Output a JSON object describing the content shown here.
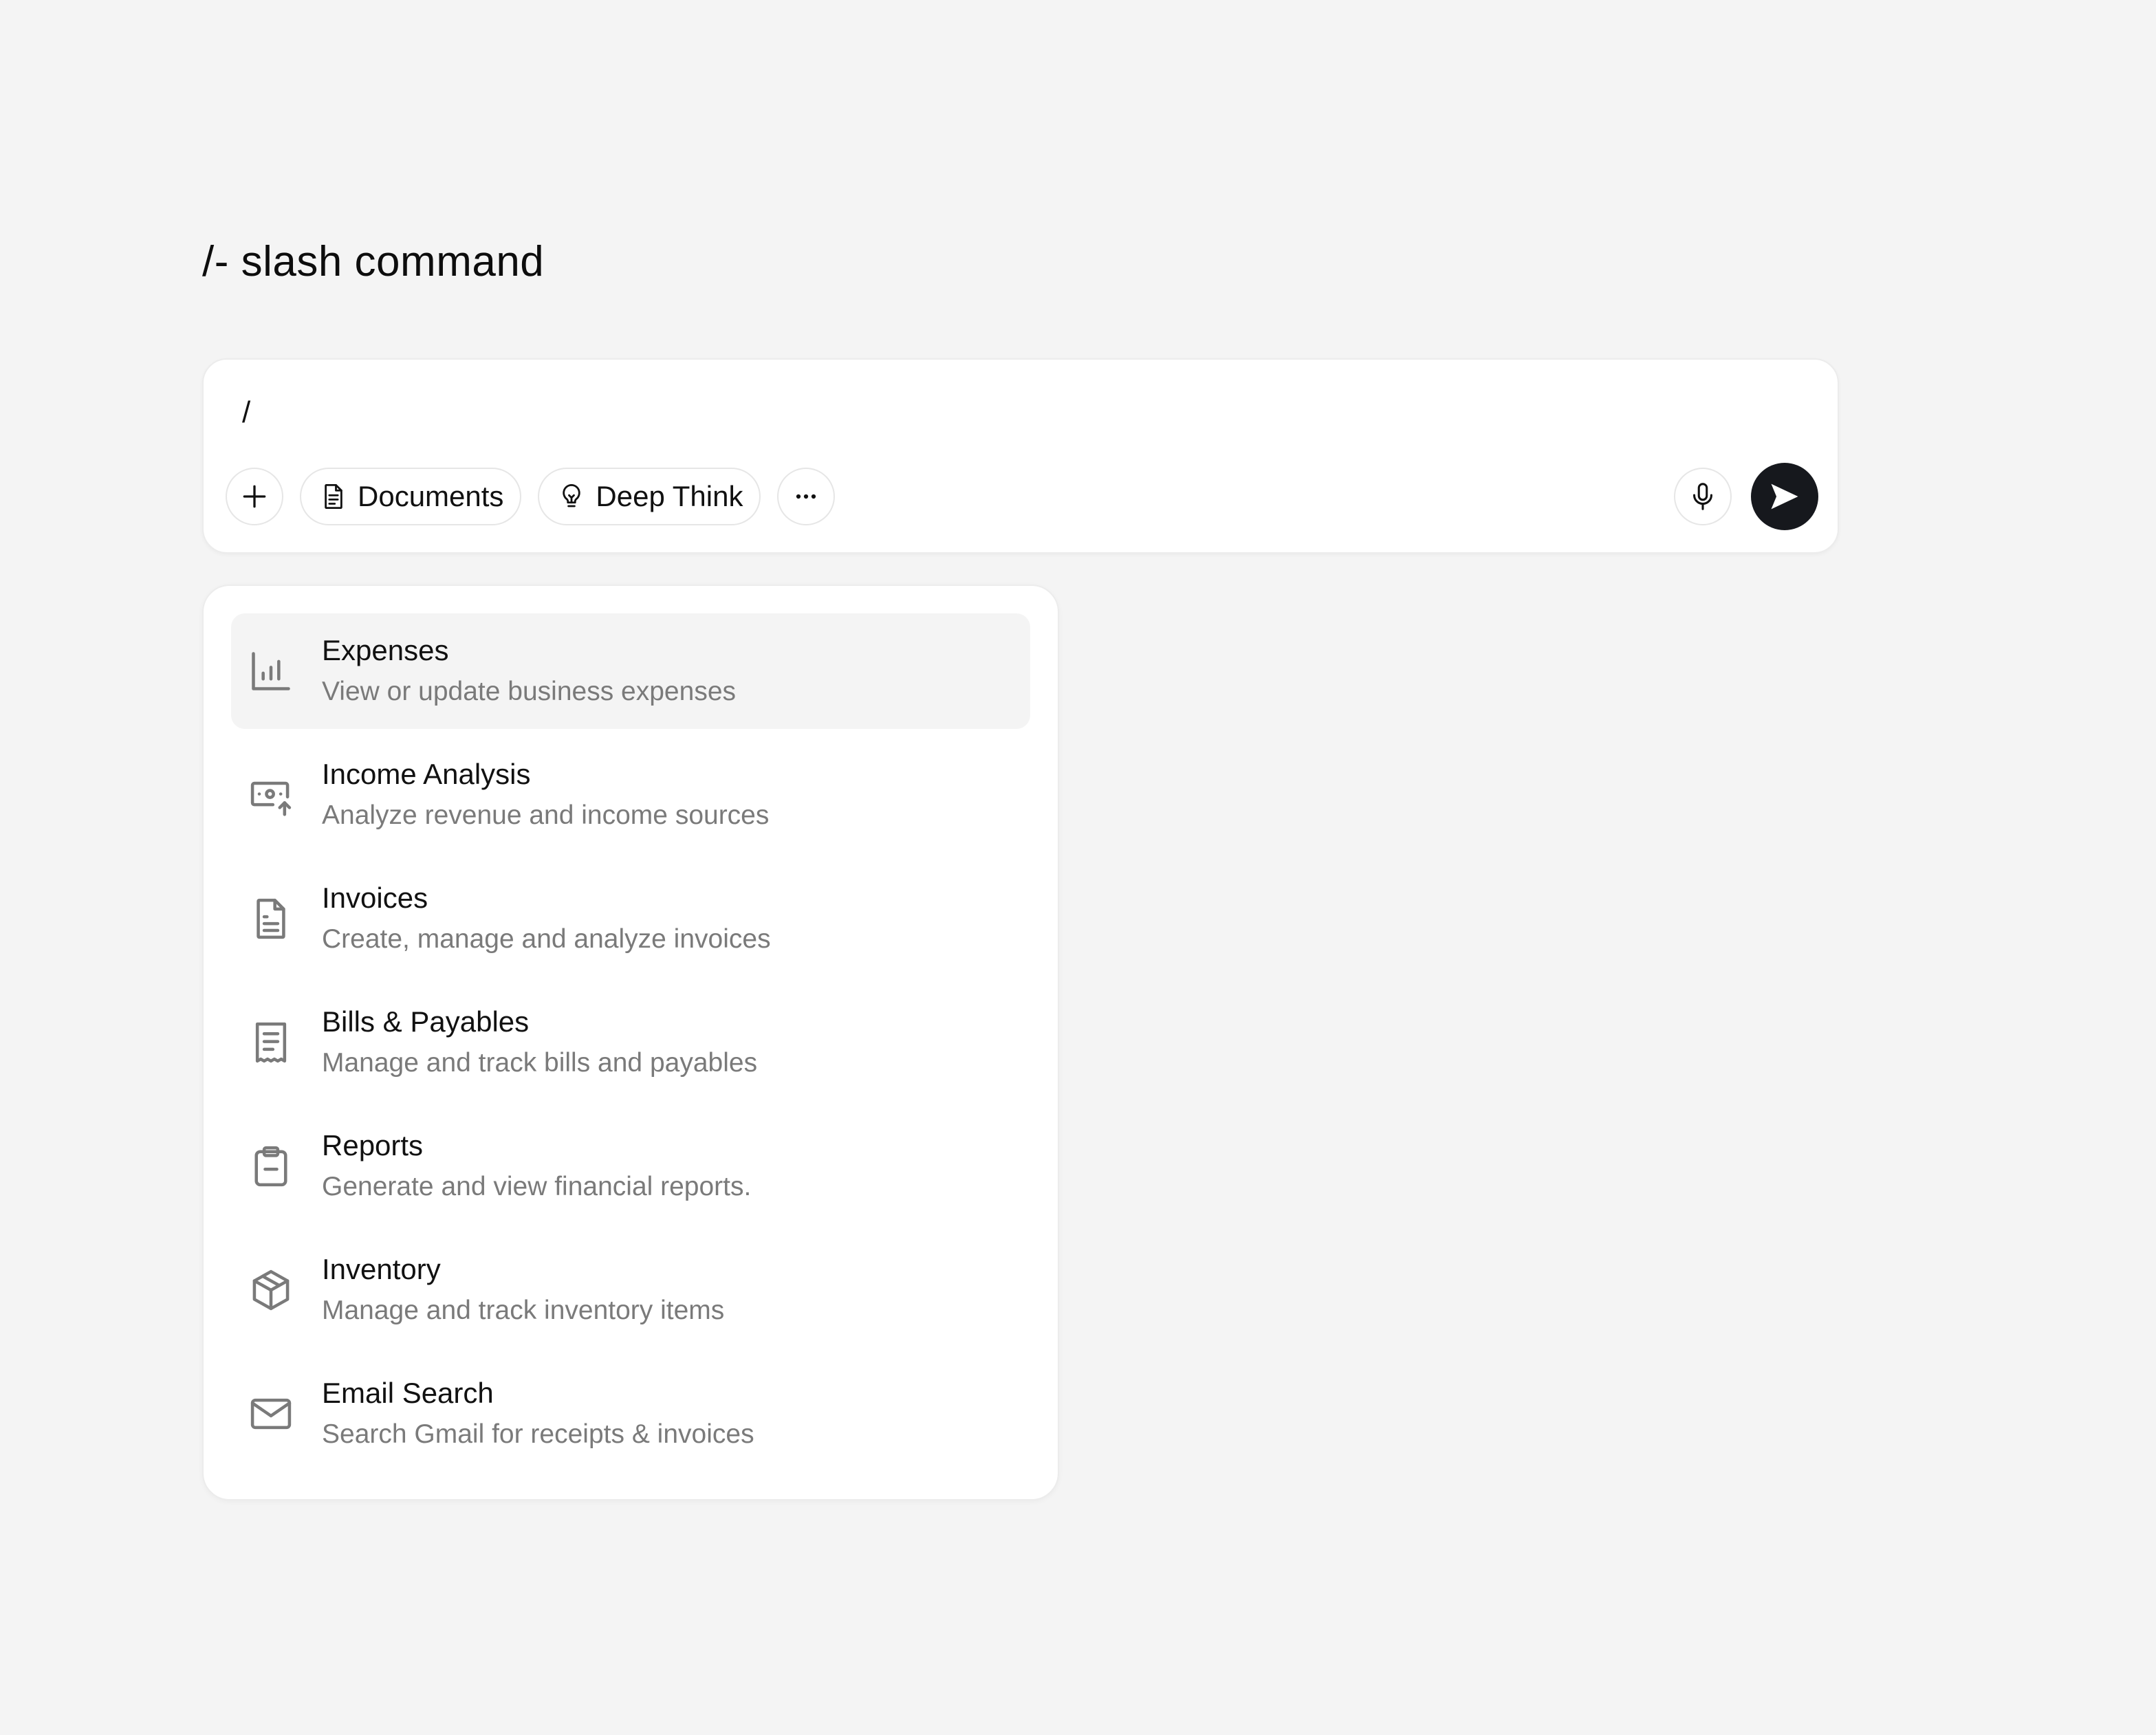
{
  "page": {
    "title": "/- slash command"
  },
  "composer": {
    "input_value": "/",
    "toolbar": {
      "add_icon": "plus-icon",
      "documents_label": "Documents",
      "documents_icon": "document-icon",
      "deep_think_label": "Deep Think",
      "deep_think_icon": "lightbulb-icon",
      "more_icon": "ellipsis-icon",
      "mic_icon": "microphone-icon",
      "send_icon": "send-icon"
    }
  },
  "slash_menu": {
    "items": [
      {
        "title": "Expenses",
        "description": "View or update business expenses",
        "icon": "bar-chart-icon",
        "active": true
      },
      {
        "title": "Income Analysis",
        "description": "Analyze revenue and income sources",
        "icon": "cash-upload-icon",
        "active": false
      },
      {
        "title": "Invoices",
        "description": "Create, manage and analyze invoices",
        "icon": "document-icon",
        "active": false
      },
      {
        "title": "Bills & Payables",
        "description": "Manage and track bills and payables",
        "icon": "receipt-icon",
        "active": false
      },
      {
        "title": "Reports",
        "description": "Generate and view financial reports.",
        "icon": "clipboard-icon",
        "active": false
      },
      {
        "title": "Inventory",
        "description": "Manage and track inventory items",
        "icon": "box-icon",
        "active": false
      },
      {
        "title": "Email Search",
        "description": "Search Gmail for receipts & invoices",
        "icon": "envelope-icon",
        "active": false
      }
    ]
  },
  "colors": {
    "background": "#f4f4f4",
    "surface": "#ffffff",
    "send_button": "#16181d",
    "muted_text": "#7a7a7a",
    "icon_gray": "#7a7a7a"
  }
}
